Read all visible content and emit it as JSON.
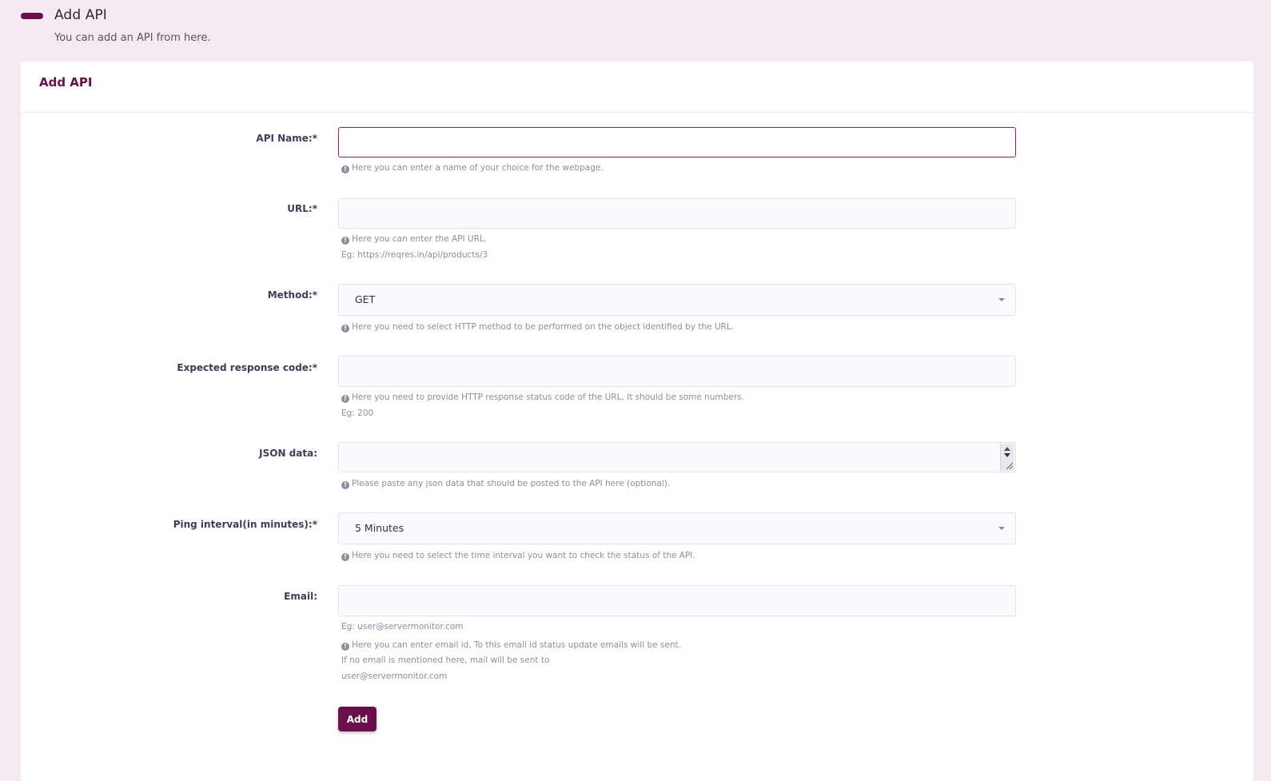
{
  "header": {
    "title": "Add API",
    "subtitle": "You can add an API from here."
  },
  "card": {
    "title": "Add API"
  },
  "form": {
    "api_name": {
      "label": "API Name:*",
      "value": "",
      "help": "Here you can enter a name of your choice for the webpage."
    },
    "url": {
      "label": "URL:*",
      "value": "",
      "help": "Here you can enter the API URL.",
      "example": "Eg: https://reqres.in/api/products/3"
    },
    "method": {
      "label": "Method:*",
      "selected": "GET",
      "help": "Here you need to select HTTP method to be performed on the object identified by the URL."
    },
    "response_code": {
      "label": "Expected response code:*",
      "value": "",
      "help": "Here you need to provide HTTP response status code of the URL, It should be some numbers.",
      "example": "Eg: 200"
    },
    "json_data": {
      "label": "JSON data:",
      "value": "",
      "help": "Please paste any json data that should be posted to the API here (optional)."
    },
    "ping_interval": {
      "label": "Ping interval(in minutes):*",
      "selected": "5 Minutes",
      "help": "Here you need to select the time interval you want to check the status of the API."
    },
    "email": {
      "label": "Email:",
      "value": "",
      "example": "Eg: user@servermonitor.com",
      "help": "Here you can enter email id, To this email id status update emails will be sent.",
      "help_line2": "If no email is mentioned here, mail will be sent to",
      "help_line3": "user@servermonitor.com"
    },
    "submit_label": "Add"
  },
  "icons": {
    "info": "info-circle-icon",
    "caret": "chevron-down-icon"
  },
  "colors": {
    "accent": "#6b0f4b",
    "page_bg": "#f5e9f2",
    "focus_border": "#a01779"
  }
}
